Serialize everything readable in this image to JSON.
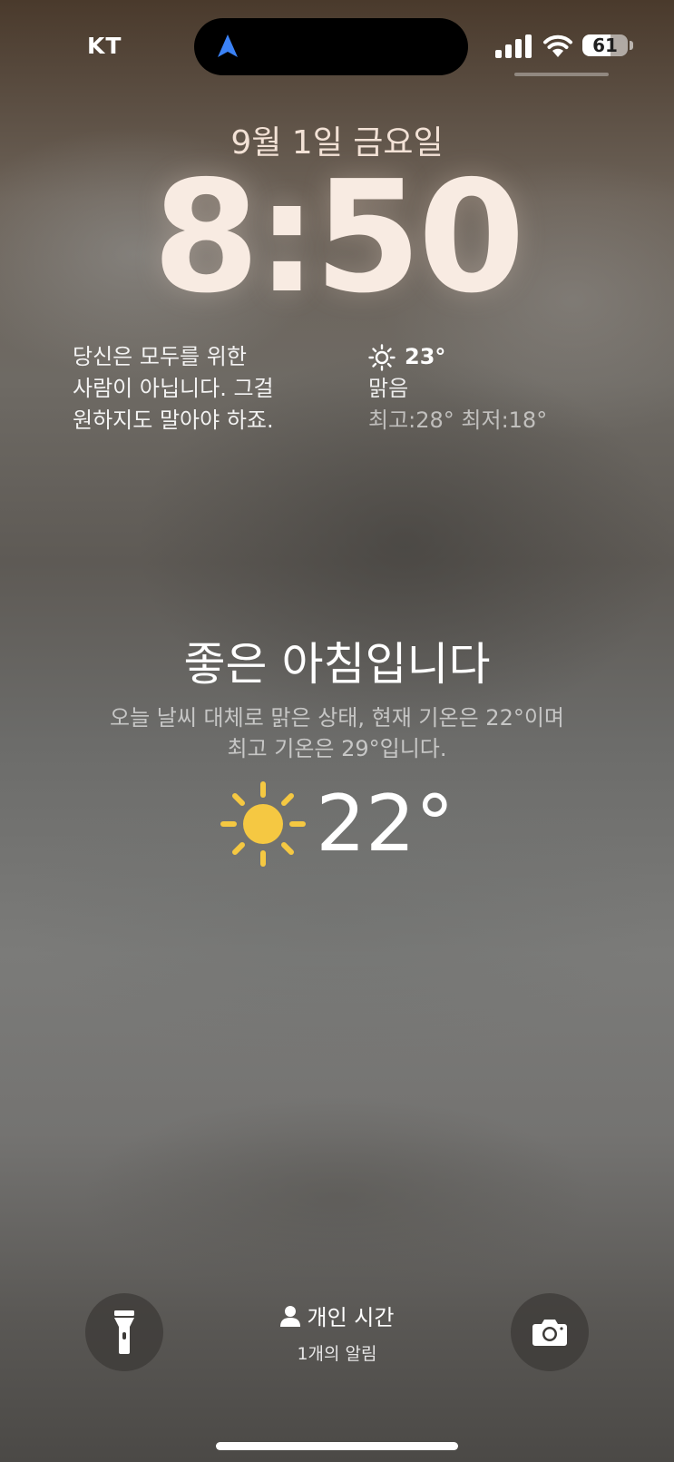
{
  "status_bar": {
    "carrier": "KT",
    "battery_percent": "61",
    "battery_level": 0.61,
    "signal_bars": 4,
    "location_icon_color": "#3b82f6"
  },
  "lock_screen": {
    "date": "9월 1일 금요일",
    "time": "8:50"
  },
  "widgets": {
    "quote": {
      "line1": "당신은 모두를 위한",
      "line2": "사람이 아닙니다. 그걸",
      "line3": "원하지도 말아야 하죠."
    },
    "weather": {
      "icon": "sun-icon",
      "temperature": "23°",
      "condition": "맑음",
      "hi_lo": "최고:28° 최저:18°"
    }
  },
  "greeting": {
    "title": "좋은 아침입니다",
    "summary_line1": "오늘 날씨 대체로 맑은 상태, 현재 기온은 22°이며",
    "summary_line2": "최고 기온은 29°입니다.",
    "weather_icon": "sun-icon",
    "weather_icon_color": "#f5c842",
    "current_temp": "22°"
  },
  "bottom": {
    "flashlight_icon": "flashlight-icon",
    "camera_icon": "camera-icon",
    "focus_icon": "person-icon",
    "focus_label": "개인 시간",
    "notification_count": "1개의 알림"
  }
}
